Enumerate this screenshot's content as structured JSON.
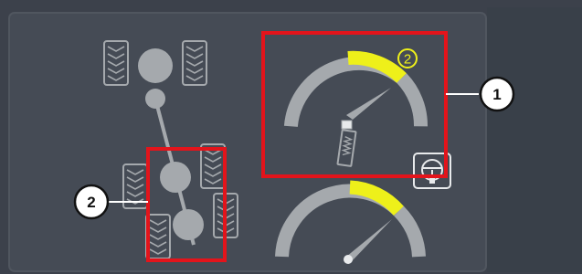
{
  "colors": {
    "outer_background": "#3c414b",
    "panel_background": "#454b55",
    "right_background": "#394049",
    "icon_gray": "#a5a9ad",
    "gauge_active": "#eef01a",
    "highlight_box": "#e3141b",
    "callout_fill": "#ffffff"
  },
  "callouts": [
    {
      "label": "1",
      "target": "steering-angle-gauge"
    },
    {
      "label": "2",
      "target": "rear-axle-highlight"
    }
  ],
  "upper_gauge": {
    "marker_label": "2",
    "icon": "steering-sensor-icon"
  },
  "lower_gauge": {
    "icon": "needle-pivot-icon"
  },
  "mode_button": {
    "icon": "steering-wheel-icon"
  }
}
